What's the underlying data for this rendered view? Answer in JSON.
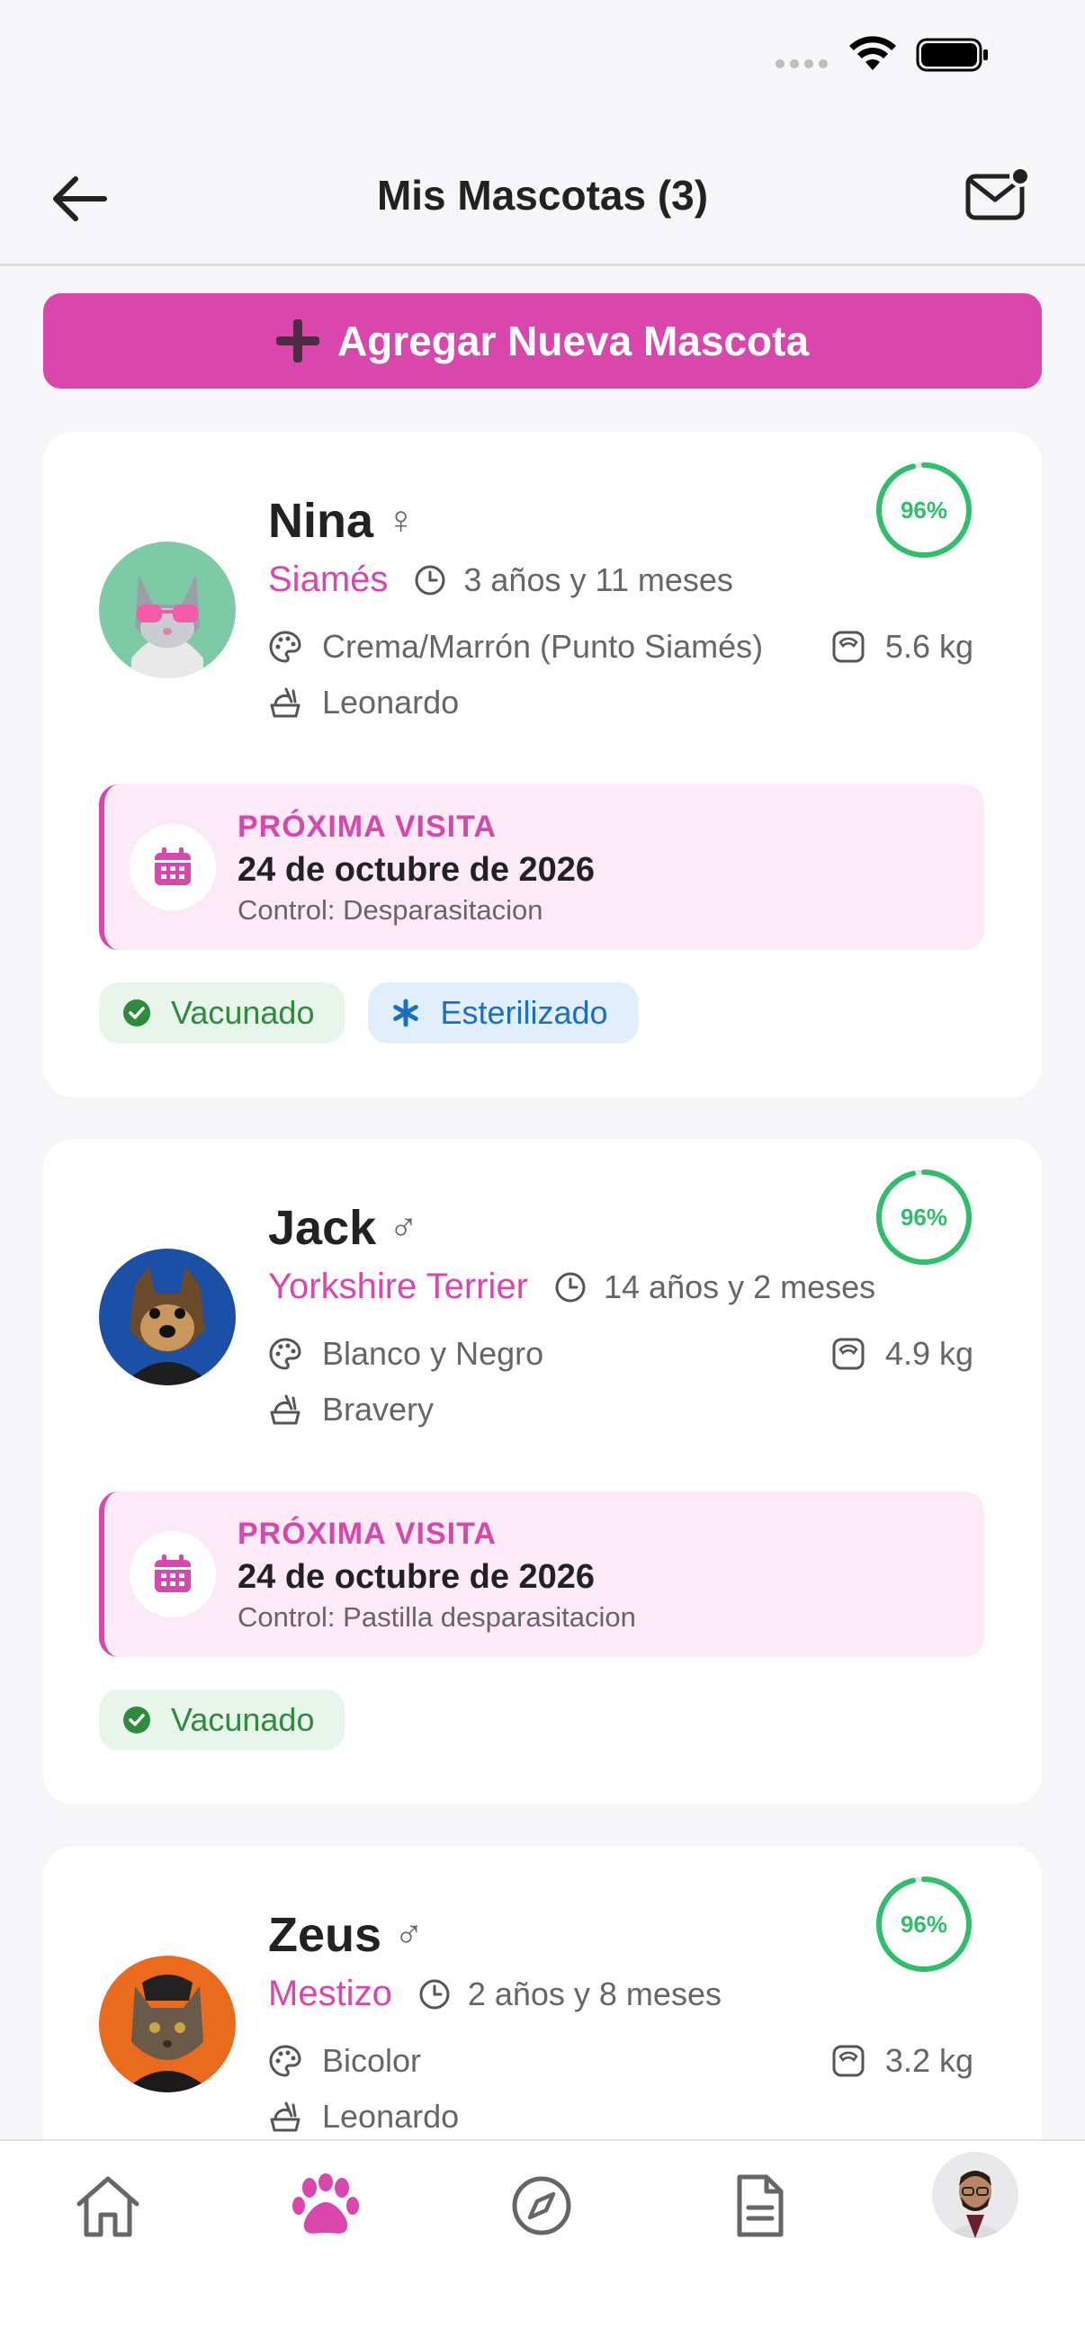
{
  "header": {
    "title": "Mis Mascotas (3)"
  },
  "add_button": {
    "label": "Agregar Nueva Mascota"
  },
  "colors": {
    "accent": "#d946ac",
    "progress": "#2fbf6a",
    "vaccinated": "#2e8b3e",
    "sterilized": "#1a6fc4"
  },
  "pets": [
    {
      "name": "Nina",
      "gender_symbol": "♀",
      "health_percent": "96%",
      "health_value": 96,
      "breed": "Siamés",
      "age": "3 años y 11 meses",
      "color": "Crema/Marrón (Punto Siamés)",
      "weight": "5.6 kg",
      "food": "Leonardo",
      "visit": {
        "label": "PRÓXIMA VISITA",
        "date": "24 de octubre de 2026",
        "note": "Control: Desparasitacion"
      },
      "badges": [
        "Vacunado",
        "Esterilizado"
      ]
    },
    {
      "name": "Jack",
      "gender_symbol": "♂",
      "health_percent": "96%",
      "health_value": 96,
      "breed": "Yorkshire Terrier",
      "age": "14 años y 2 meses",
      "color": "Blanco y Negro",
      "weight": "4.9 kg",
      "food": "Bravery",
      "visit": {
        "label": "PRÓXIMA VISITA",
        "date": "24 de octubre de 2026",
        "note": "Control: Pastilla desparasitacion"
      },
      "badges": [
        "Vacunado"
      ]
    },
    {
      "name": "Zeus",
      "gender_symbol": "♂",
      "health_percent": "96%",
      "health_value": 96,
      "breed": "Mestizo",
      "age": "2 años y 8 meses",
      "color": "Bicolor",
      "weight": "3.2 kg",
      "food": "Leonardo"
    }
  ],
  "nav": {
    "items": [
      "home-icon",
      "paw-icon",
      "compass-icon",
      "document-icon",
      "profile-avatar"
    ],
    "active": "paw-icon"
  }
}
